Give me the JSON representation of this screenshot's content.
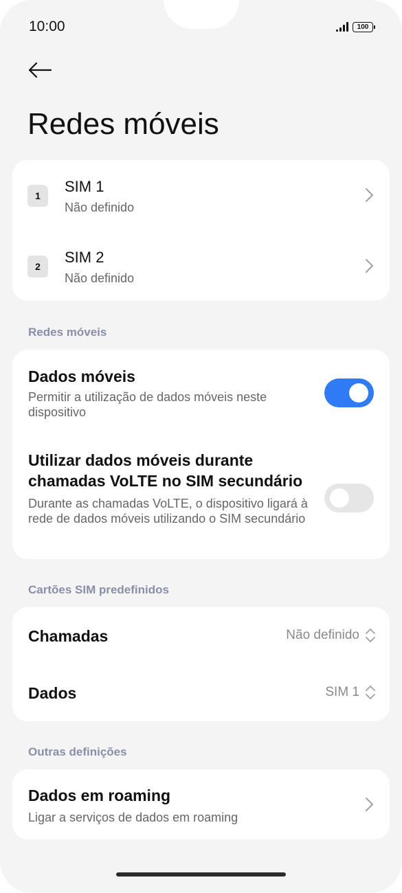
{
  "status_bar": {
    "time": "10:00",
    "battery": "100"
  },
  "page": {
    "title": "Redes móveis"
  },
  "sims": [
    {
      "badge": "1",
      "title": "SIM 1",
      "subtitle": "Não definido"
    },
    {
      "badge": "2",
      "title": "SIM 2",
      "subtitle": "Não definido"
    }
  ],
  "mobile_networks": {
    "section_label": "Redes móveis",
    "mobile_data": {
      "title": "Dados móveis",
      "description": "Permitir a utilização de dados móveis neste dispositivo",
      "enabled": true
    },
    "volte_data": {
      "title": "Utilizar dados móveis durante chamadas VoLTE no SIM secundário",
      "description": "Durante as chamadas VoLTE, o dispositivo ligará à rede de dados móveis utilizando o SIM secundário",
      "enabled": false
    }
  },
  "default_sim": {
    "section_label": "Cartões SIM predefinidos",
    "calls": {
      "label": "Chamadas",
      "value": "Não definido"
    },
    "data": {
      "label": "Dados",
      "value": "SIM 1"
    }
  },
  "other": {
    "section_label": "Outras definições",
    "roaming": {
      "title": "Dados em roaming",
      "description": "Ligar a serviços de dados em roaming"
    }
  },
  "colors": {
    "accent": "#2f7bf5",
    "section_label": "#8a8fa8",
    "background": "#f4f4f4"
  }
}
